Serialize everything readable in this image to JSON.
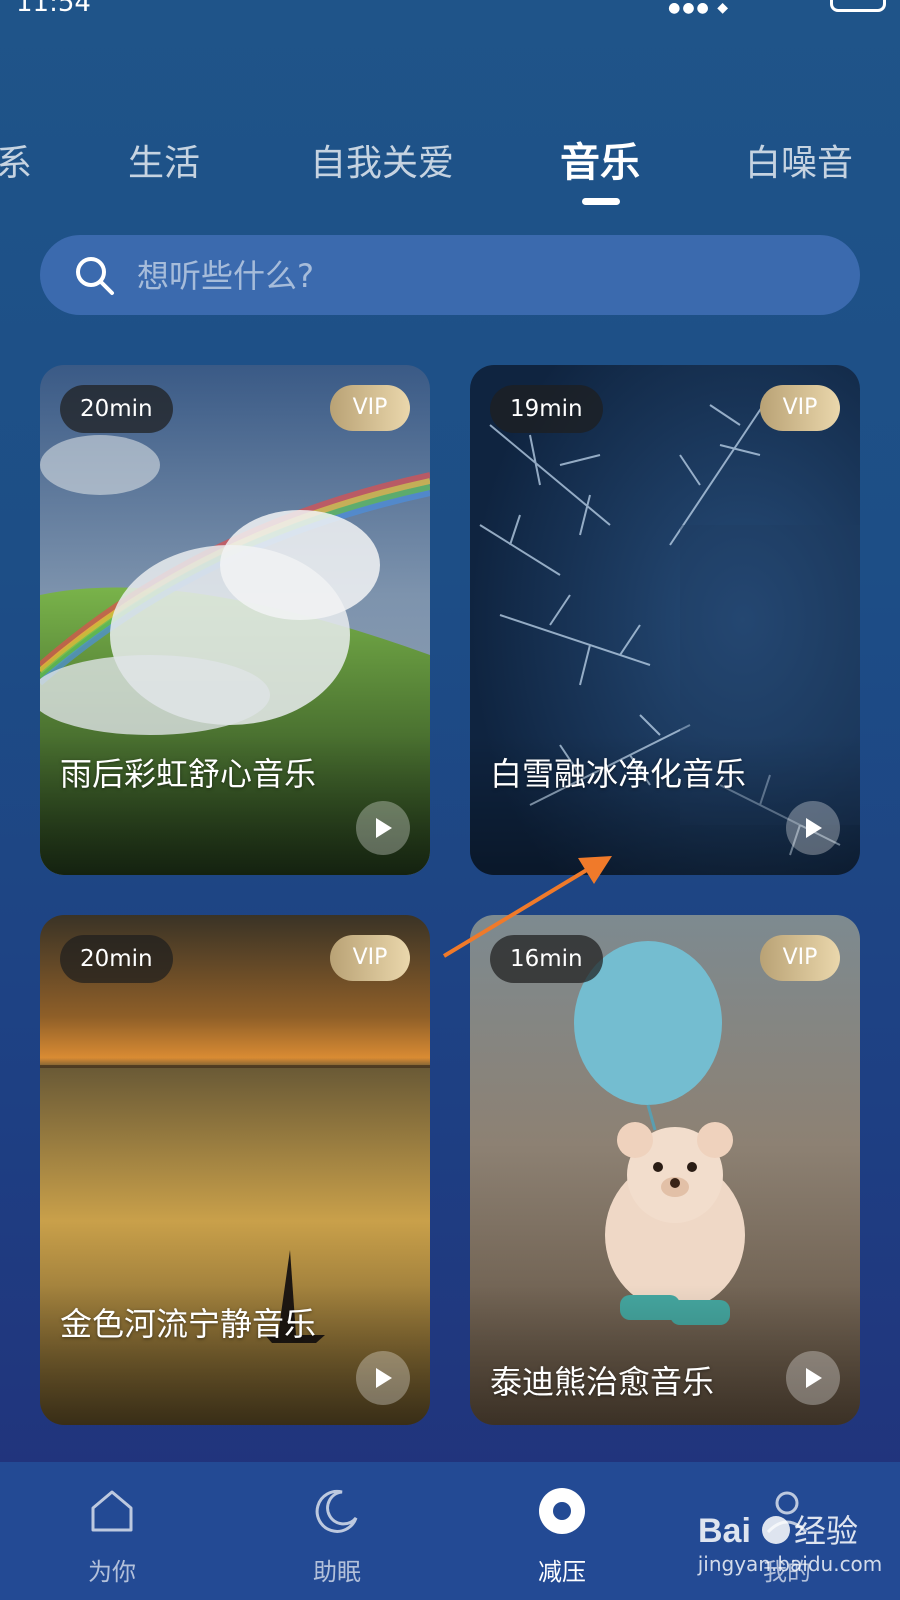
{
  "status_bar": {
    "time": "11:54"
  },
  "tabs": [
    {
      "label": "系"
    },
    {
      "label": "生活"
    },
    {
      "label": "自我关爱"
    },
    {
      "label": "音乐"
    },
    {
      "label": "白噪音"
    }
  ],
  "active_tab": "音乐",
  "search": {
    "placeholder": "想听些什么?"
  },
  "cards": [
    {
      "duration": "20min",
      "badge": "VIP",
      "title": "雨后彩虹舒心音乐",
      "progress": 0
    },
    {
      "duration": "19min",
      "badge": "VIP",
      "title": "白雪融冰净化音乐",
      "progress": 0
    },
    {
      "duration": "20min",
      "badge": "VIP",
      "title": "金色河流宁静音乐",
      "progress": 0
    },
    {
      "duration": "16min",
      "badge": "VIP",
      "title": "泰迪熊治愈音乐",
      "progress": 0
    }
  ],
  "bottom_nav": [
    {
      "label": "为你",
      "icon": "home-icon"
    },
    {
      "label": "助眠",
      "icon": "moon-icon"
    },
    {
      "label": "减压",
      "icon": "target-icon"
    },
    {
      "label": "我的",
      "icon": "profile-icon"
    }
  ],
  "watermark": {
    "text": "jingyan.baidu.com"
  },
  "colors": {
    "background": "#1f5489",
    "search_bg": "#3b6aae",
    "vip_gold": "#d6c191",
    "nav_bg": "#234a94",
    "arrow": "#f07a2a"
  }
}
